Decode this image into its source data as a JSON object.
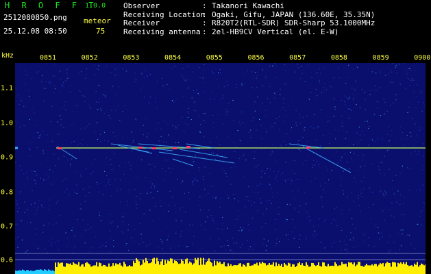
{
  "header": {
    "app_name": "H R O F F T",
    "version": "1.0.0",
    "filename": "2512080850.png",
    "timestamp": "25.12.08 08:50",
    "meteor_label": "meteor",
    "meteor_count": "75"
  },
  "info": [
    {
      "key": "Observer",
      "value": "Takanori Kawachi"
    },
    {
      "key": "Receiving Location",
      "value": "Ogaki, Gifu, JAPAN (136.60E, 35.35N)"
    },
    {
      "key": "Receiver",
      "value": "R820T2(RTL-SDR) SDR-Sharp 53.1000MHz"
    },
    {
      "key": "Receiving antenna",
      "value": "2el-HB9CV Vertical (el. E-W)"
    }
  ],
  "spectrogram": {
    "y_unit": "kHz",
    "y_ticks": [
      "1.1",
      "1.0",
      "0.9",
      "0.8",
      "0.7",
      "0.6"
    ],
    "x_ticks": [
      "0851",
      "0852",
      "0853",
      "0854",
      "0855",
      "0856",
      "0857",
      "0858",
      "0859",
      "0900"
    ],
    "colors": {
      "background": "#0a0f6e",
      "noise_a": "#2a4fd8",
      "noise_b": "#3fb0ff",
      "carrier": "#c8ff60",
      "echo": "#ff4060",
      "level_yellow": "#ffee00",
      "level_cyan": "#22ccff",
      "tick_color": "#ffff44"
    }
  }
}
